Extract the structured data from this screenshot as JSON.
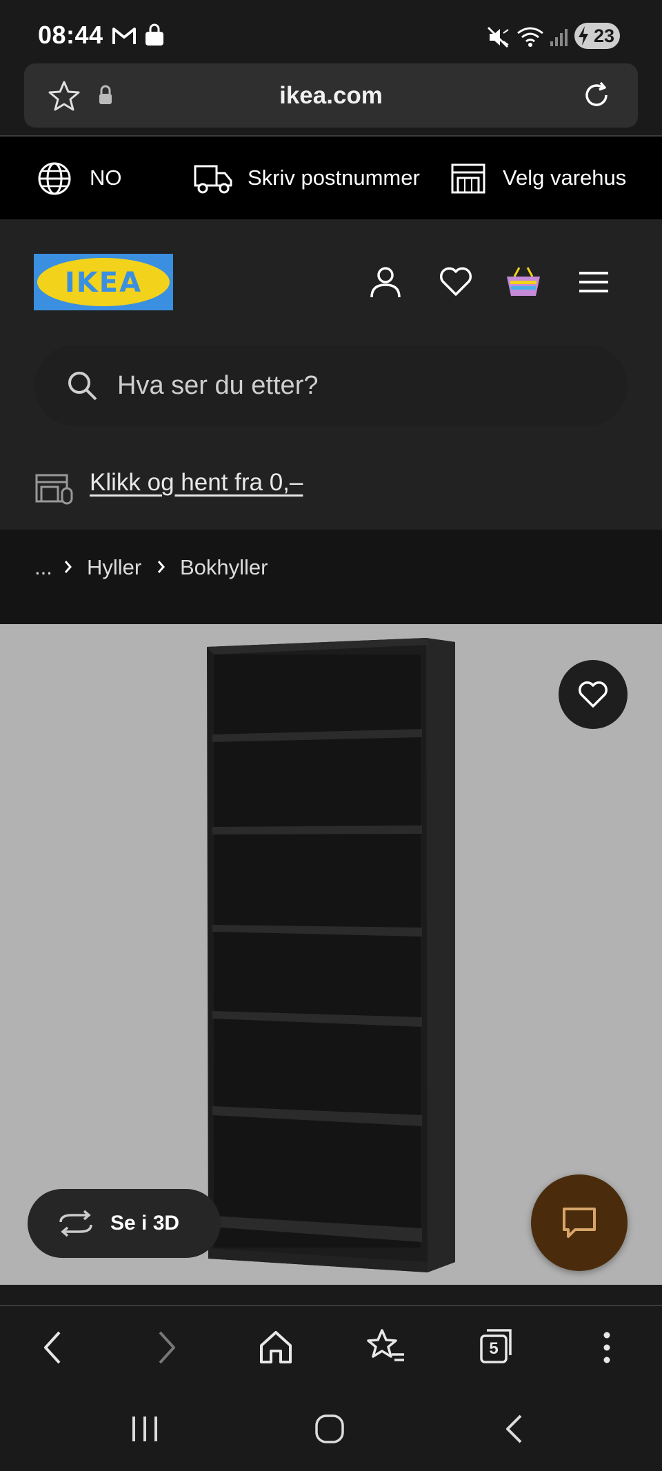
{
  "status_bar": {
    "time": "08:44",
    "battery": "23"
  },
  "browser": {
    "url": "ikea.com",
    "tab_count": "5"
  },
  "top_strip": {
    "country": "NO",
    "postcode": "Skriv postnummer",
    "store": "Velg varehus"
  },
  "header": {
    "logo_text": "IKEA",
    "search_placeholder": "Hva ser du etter?",
    "click_collect": "Klikk og hent fra 0,–"
  },
  "breadcrumb": {
    "ellipsis": "...",
    "items": [
      "Hyller",
      "Bokhyller"
    ]
  },
  "product": {
    "view_3d": "Se i 3D"
  },
  "colors": {
    "logo_blue": "#3b8fe0",
    "logo_yellow": "#f2d21a",
    "chat": "#4a2c0c"
  }
}
